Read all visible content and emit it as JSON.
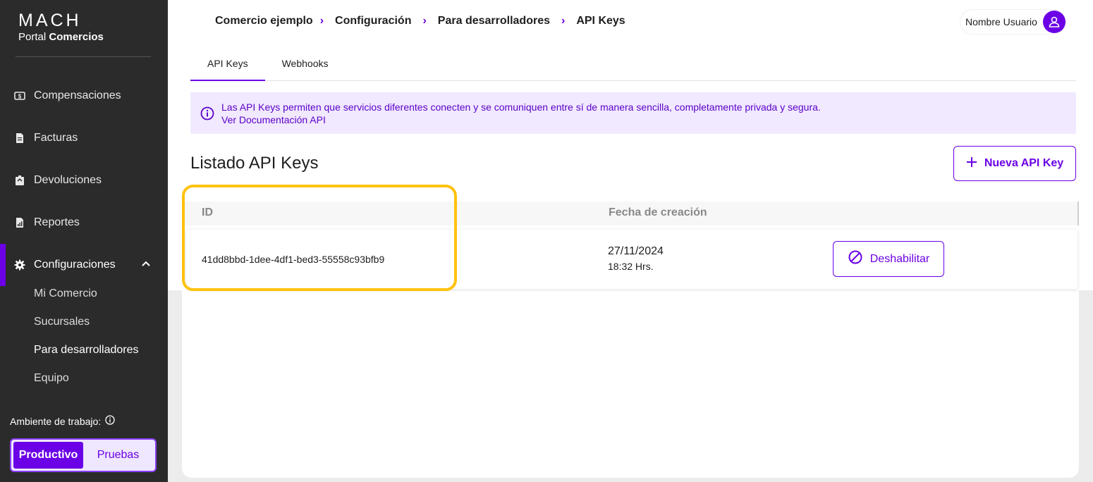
{
  "brand": {
    "logo": "MACH",
    "sub_regular": "Portal",
    "sub_bold": "Comercios"
  },
  "sidebar": {
    "items": [
      {
        "label": "Compensaciones",
        "icon": "dollar-card-icon"
      },
      {
        "label": "Facturas",
        "icon": "invoice-icon"
      },
      {
        "label": "Devoluciones",
        "icon": "return-box-icon"
      },
      {
        "label": "Reportes",
        "icon": "report-chart-icon"
      },
      {
        "label": "Configuraciones",
        "icon": "gear-icon",
        "expanded": true
      }
    ],
    "sub_items": [
      {
        "label": "Mi Comercio"
      },
      {
        "label": "Sucursales"
      },
      {
        "label": "Para desarrolladores",
        "current": true
      },
      {
        "label": "Equipo"
      }
    ],
    "env_label": "Ambiente de trabajo:",
    "env_options": [
      "Productivo",
      "Pruebas"
    ],
    "env_selected": "Productivo"
  },
  "breadcrumb": [
    "Comercio ejemplo",
    "Configuración",
    "Para desarrolladores",
    "API Keys"
  ],
  "user": {
    "name": "Nombre Usuario"
  },
  "tabs": [
    {
      "label": "API Keys",
      "active": true
    },
    {
      "label": "Webhooks",
      "active": false
    }
  ],
  "info": {
    "text": "Las API Keys permiten que servicios diferentes conecten y se comuniquen entre sí de manera sencilla, completamente privada y segura.",
    "link": "Ver Documentación API"
  },
  "list": {
    "title": "Listado API Keys",
    "new_button": "Nueva API Key",
    "columns": [
      "ID",
      "Fecha de creación"
    ],
    "rows": [
      {
        "id": "41dd8bbd-1dee-4df1-bed3-55558c93bfb9",
        "date": "27/11/2024",
        "time": "18:32 Hrs.",
        "action": "Deshabilitar"
      }
    ]
  },
  "colors": {
    "accent": "#6b00e6",
    "highlight": "#ffc20e",
    "sidebar": "#2b2b2b",
    "info_bg": "#f1e9ff"
  }
}
